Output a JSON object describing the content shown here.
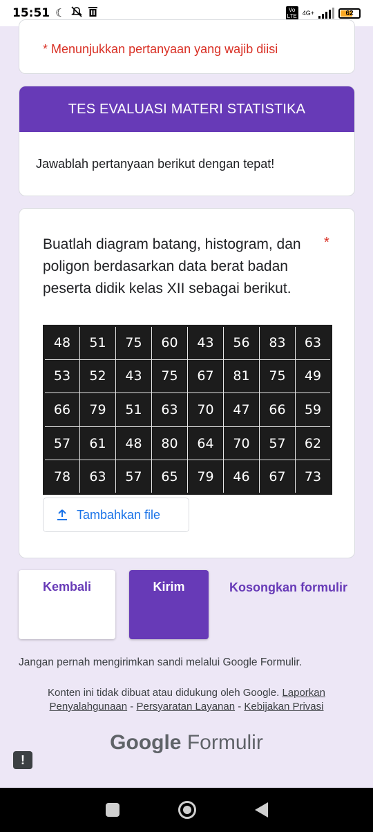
{
  "status_bar": {
    "time": "15:51",
    "battery_level": "62",
    "network": "4G+"
  },
  "form": {
    "required_note": "* Menunjukkan pertanyaan yang wajib diisi",
    "title": "TES EVALUASI MATERI STATISTIKA",
    "description": "Jawablah pertanyaan berikut dengan tepat!",
    "question": {
      "text": "Buatlah diagram batang, histogram, dan poligon berdasarkan data berat badan peserta didik kelas XII sebagai berikut.",
      "required_marker": "*",
      "data_rows": [
        [
          "48",
          "51",
          "75",
          "60",
          "43",
          "56",
          "83",
          "63"
        ],
        [
          "53",
          "52",
          "43",
          "75",
          "67",
          "81",
          "75",
          "49"
        ],
        [
          "66",
          "79",
          "51",
          "63",
          "70",
          "47",
          "66",
          "59"
        ],
        [
          "57",
          "61",
          "48",
          "80",
          "64",
          "70",
          "57",
          "62"
        ],
        [
          "78",
          "63",
          "57",
          "65",
          "79",
          "46",
          "67",
          "73"
        ]
      ],
      "upload_label": "Tambahkan file"
    },
    "buttons": {
      "back": "Kembali",
      "submit": "Kirim",
      "clear": "Kosongkan formulir"
    },
    "password_warning": "Jangan pernah mengirimkan sandi melalui Google Formulir.",
    "disclaimer": {
      "text": "Konten ini tidak dibuat atau didukung oleh Google.",
      "link_report": "Laporkan Penyalahgunaan",
      "sep1": "-",
      "link_terms": "Persyaratan Layanan",
      "sep2": "-",
      "link_privacy": "Kebijakan Privasi"
    },
    "brand": {
      "google": "Google",
      "product": "Formulir"
    },
    "feedback_icon": "!"
  },
  "colors": {
    "accent": "#673ab7",
    "background": "#ede7f6",
    "required": "#d93025",
    "link": "#1a73e8"
  }
}
